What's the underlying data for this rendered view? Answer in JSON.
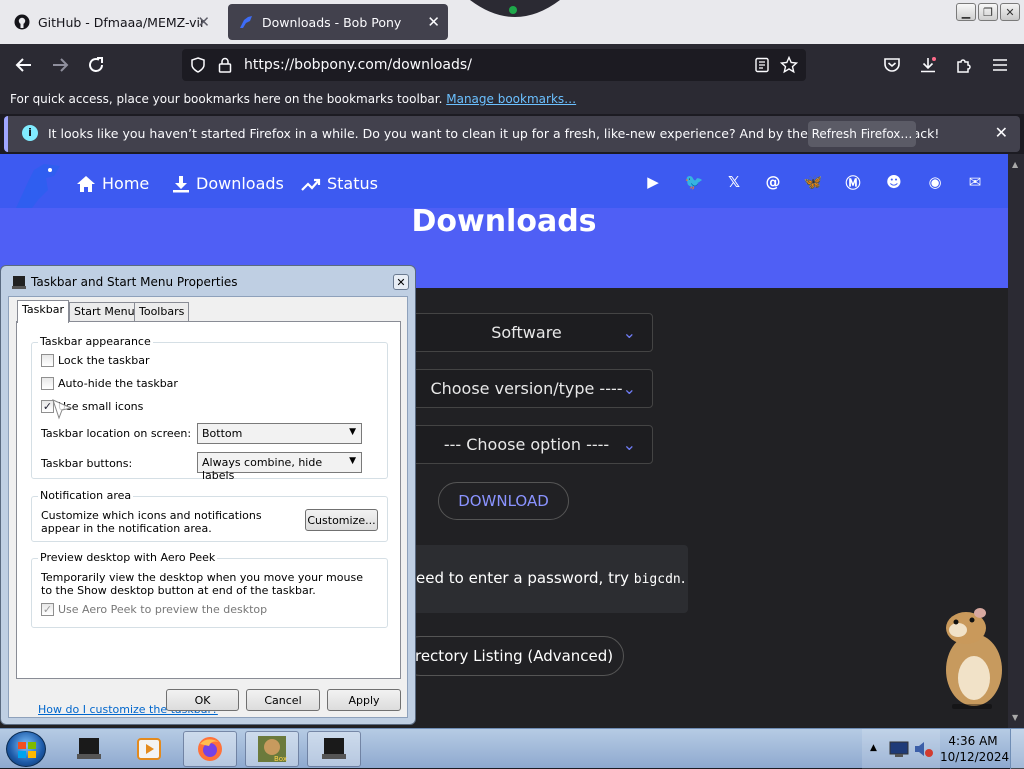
{
  "browser": {
    "tabs": [
      {
        "title": "GitHub - Dfmaaa/MEMZ-virus",
        "active": false
      },
      {
        "title": "Downloads - Bob Pony",
        "active": true
      }
    ],
    "url": "https://bobpony.com/downloads/",
    "bookmarks_msg": "For quick access, place your bookmarks here on the bookmarks toolbar.",
    "bookmarks_link": "Manage bookmarks…",
    "notification": {
      "message": "It looks like you haven’t started Firefox in a while. Do you want to clean it up for a fresh, like-new experience? And by the way, welcome back!",
      "button": "Refresh Firefox…"
    }
  },
  "site": {
    "nav": {
      "home": "Home",
      "downloads": "Downloads",
      "status": "Status"
    },
    "social_icons": [
      "youtube-icon",
      "twitter-icon",
      "x-icon",
      "threads-icon",
      "bluesky-icon",
      "mastodon-icon",
      "discord-icon",
      "github-icon",
      "mail-icon"
    ],
    "heading": "Downloads",
    "select1": "Software",
    "select2": "Choose version/type ----",
    "select3": "--- Choose option ----",
    "download_button": "DOWNLOAD",
    "info_text": "eed to enter a password, try ",
    "info_code": "bigcdn",
    "info_end": ".",
    "dir_button": "irectory Listing (Advanced)"
  },
  "dialog": {
    "title": "Taskbar and Start Menu Properties",
    "tabs": [
      "Taskbar",
      "Start Menu",
      "Toolbars"
    ],
    "appearance": {
      "label": "Taskbar appearance",
      "lock": "Lock the taskbar",
      "autohide": "Auto-hide the taskbar",
      "small_icons": "Use small icons",
      "location_label": "Taskbar location on screen:",
      "location_value": "Bottom",
      "buttons_label": "Taskbar buttons:",
      "buttons_value": "Always combine, hide labels"
    },
    "notification": {
      "label": "Notification area",
      "text": "Customize which icons and notifications appear in the notification area.",
      "button": "Customize..."
    },
    "peek": {
      "label": "Preview desktop with Aero Peek",
      "text": "Temporarily view the desktop when you move your mouse to the Show desktop button at end of the taskbar.",
      "checkbox": "Use Aero Peek to preview the desktop"
    },
    "help_link": "How do I customize the taskbar?",
    "ok": "OK",
    "cancel": "Cancel",
    "apply": "Apply"
  },
  "taskbar": {
    "time": "4:36 AM",
    "date": "10/12/2024"
  }
}
